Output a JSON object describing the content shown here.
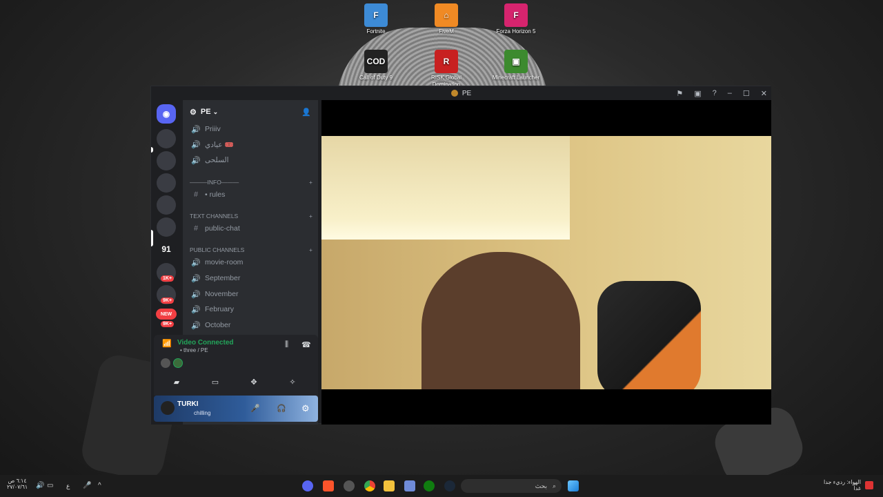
{
  "desktop": {
    "icons": [
      {
        "label": "Fortnite",
        "color": "#3d8bd6",
        "glyph": "F"
      },
      {
        "label": "FiveM",
        "color": "#f08a24",
        "glyph": "⌂"
      },
      {
        "label": "Forza Horizon 5",
        "color": "#d6246e",
        "glyph": "F"
      },
      {
        "label": "Call of Duty 9",
        "color": "#222222",
        "glyph": "COD"
      },
      {
        "label": "RISK Global Domination",
        "color": "#c82020",
        "glyph": "R"
      },
      {
        "label": "Minecraft Launcher",
        "color": "#3c8a2e",
        "glyph": "▣"
      }
    ]
  },
  "window": {
    "title": "PE",
    "controls": [
      "flag-icon",
      "inbox-icon",
      "help-icon",
      "minimize-icon",
      "maximize-icon",
      "close-icon"
    ]
  },
  "guilds": {
    "items": [
      {
        "label": "",
        "badge": ""
      },
      {
        "label": "",
        "badge": ""
      },
      {
        "label": "",
        "badge": ""
      },
      {
        "label": "",
        "badge": ""
      },
      {
        "label": "",
        "badge": ""
      },
      {
        "label": "91",
        "badge": ""
      },
      {
        "label": "",
        "badge": "1K+"
      },
      {
        "label": "",
        "badge": "9K+"
      },
      {
        "label": "NEW",
        "badge": "9K+"
      }
    ]
  },
  "server": {
    "name": "PE",
    "channels_top": [
      {
        "name": "Priiiv",
        "type": "voice"
      },
      {
        "name": "عيادي 🎟️",
        "type": "voice"
      },
      {
        "name": "السلحى",
        "type": "voice"
      }
    ],
    "categories": [
      {
        "name": "———INFO———",
        "channels": [
          {
            "name": "• rules",
            "type": "text"
          }
        ]
      },
      {
        "name": "TEXT CHANNELS",
        "channels": [
          {
            "name": "public-chat",
            "type": "text"
          }
        ]
      },
      {
        "name": "PUBLIC CHANNELS",
        "channels": [
          {
            "name": "movie-room",
            "type": "voice"
          },
          {
            "name": "September",
            "type": "voice"
          },
          {
            "name": "November",
            "type": "voice"
          },
          {
            "name": "February",
            "type": "voice"
          },
          {
            "name": "October",
            "type": "voice"
          }
        ]
      }
    ]
  },
  "voice": {
    "status": "Video Connected",
    "location": "• three / PE"
  },
  "user": {
    "name": "TURKI",
    "status": "chilling"
  },
  "taskbar": {
    "search_placeholder": "بحث",
    "clock_time": "٦:١٤ ص",
    "clock_date": "٢٧/٠٧/٦١",
    "weather": "الهواء: رديء جدا",
    "weather_sub": "غداً",
    "lang": "ع"
  }
}
